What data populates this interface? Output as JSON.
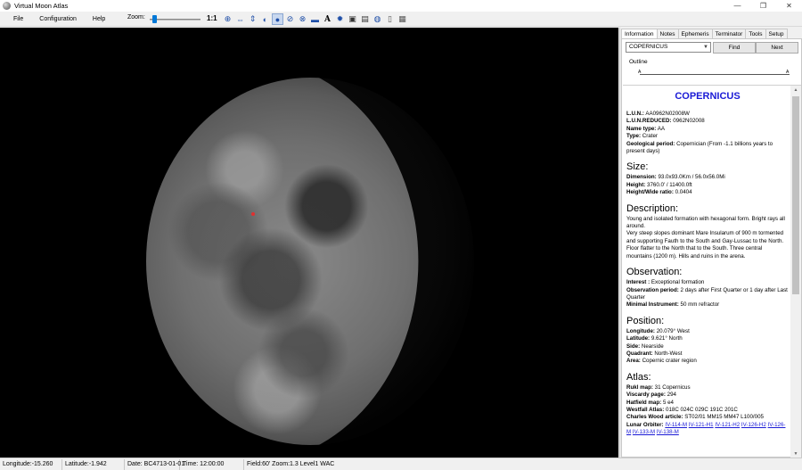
{
  "window": {
    "title": "Virtual Moon Atlas",
    "controls": [
      "—",
      "❐",
      "✕"
    ]
  },
  "menu": [
    "File",
    "Configuration",
    "Help"
  ],
  "toolbar": {
    "zoom_label": "Zoom:",
    "zoom_level": 0.05,
    "zoom_reset": "1:1",
    "icons": [
      "target-icon",
      "horizontal-flip-icon",
      "vertical-flip-icon",
      "globe-phase-icon",
      "moon-icon",
      "orbit-icon",
      "grid-globe-icon",
      "scale-bar-icon",
      "label-font-icon",
      "settings-gear-icon",
      "camera-icon",
      "calendar-icon",
      "earth-icon",
      "document-icon",
      "image-icon"
    ]
  },
  "tabs": [
    "Information",
    "Notes",
    "Ephemeris",
    "Terminator",
    "Tools",
    "Setup"
  ],
  "search": {
    "selected": "COPERNICUS",
    "find_label": "Find",
    "next_label": "Next",
    "outline_label": "Outline",
    "outline_a": "A"
  },
  "info": {
    "title": "COPERNICUS",
    "lun": "AA0962N02008W",
    "lun_reduced": "0962N02008",
    "name_type": "AA",
    "type": "Crater",
    "geological_period": "Copernician (From -1.1 billions years to present days)",
    "size_heading": "Size:",
    "dimension": "93.0x93.0Km / 56.0x56.0Mi",
    "height": "3760.0' / 11400.0ft",
    "height_wide_ratio": "0.0404",
    "description_heading": "Description:",
    "description": [
      "Young and isolated formation with hexagonal form. Bright rays all around.",
      "Very steep slopes dominant Mare Insularum of 900 m tormented and supporting Fauth to the South and Gay-Lussac to the North.",
      "Floor flatter to the North that to the South. Three central mountains (1200 m). Hills and ruins in the arena."
    ],
    "observation_heading": "Observation:",
    "interest": "Exceptional formation",
    "observation_period": "2 days after First Quarter or 1 day after Last Quarter",
    "minimal_instrument": "50 mm refractor",
    "position_heading": "Position:",
    "longitude": "20.079° West",
    "latitude": "9.621° North",
    "side": "Nearside",
    "quadrant": "North-West",
    "area": "Copernic crater region",
    "atlas_heading": "Atlas:",
    "rukl_map": "31 Copernicus",
    "viscardy_page": "294",
    "hatfield_map": "5 e4",
    "westfall_atlas": "018C 024C 029C 191C 201C",
    "charles_wood_article": "ST02/01 MM15 MM47 L100/005",
    "lunar_orbiter_links": [
      "IV-114-M",
      "IV-121-H1",
      "IV-121-H2",
      "IV-126-H2",
      "IV-126-M",
      "IV-133-M",
      "IV-138-M"
    ]
  },
  "labels": {
    "lun": "L.U.N.:",
    "lun_reduced": "L.U.N.REDUCED:",
    "name_type": "Name type:",
    "type": "Type:",
    "geological_period": "Geological period:",
    "dimension": "Dimension:",
    "height": "Height:",
    "height_wide_ratio": "Height/Wide ratio:",
    "interest": "Interest :",
    "observation_period": "Observation period:",
    "minimal_instrument": "Minimal Instrument:",
    "longitude": "Longitude:",
    "latitude": "Latitude:",
    "side": "Side:",
    "quadrant": "Quadrant:",
    "area": "Area:",
    "rukl_map": "Rukl map:",
    "viscardy_page": "Viscardy page:",
    "hatfield_map": "Hatfield map:",
    "westfall_atlas": "Westfall Atlas:",
    "charles_wood_article": "Charles Wood article:",
    "lunar_orbiter": "Lunar Orbiter:"
  },
  "status": {
    "longitude": "Longitude:-15.260",
    "latitude": "Latitude:-1.942",
    "date": "Date: BC4713-01-01",
    "time": "Time: 12:00:00",
    "field": "Field:60' Zoom:1.3  Level1 WAC"
  }
}
